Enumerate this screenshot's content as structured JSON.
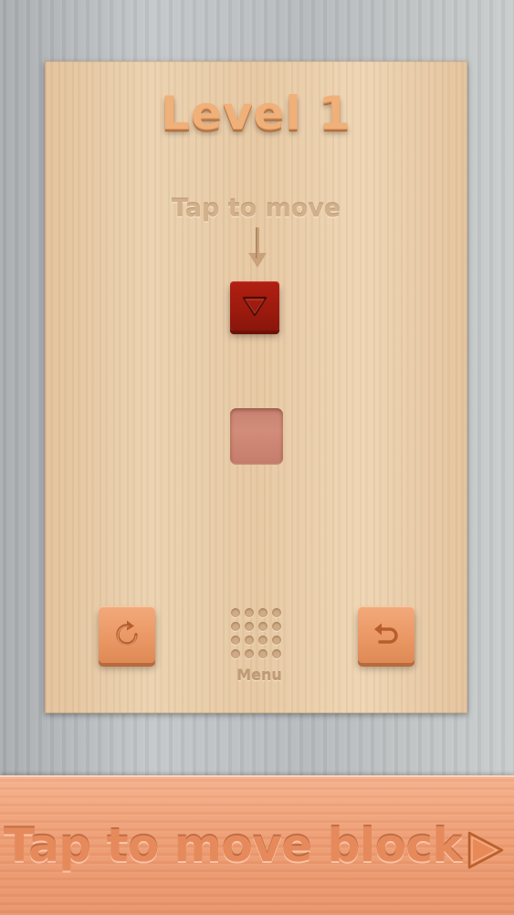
{
  "board": {
    "title": "Level 1",
    "hint": "Tap to move",
    "block": {
      "color": "#a51c10",
      "direction_icon": "triangle-down-icon"
    },
    "target": {
      "color": "#c98271"
    }
  },
  "controls": {
    "restart_icon": "restart-icon",
    "undo_icon": "undo-icon",
    "menu_icon": "grid-dots-icon",
    "menu_label": "Menu"
  },
  "banner": {
    "text": "Tap to move block",
    "arrow_icon": "play-arrow-icon"
  },
  "colors": {
    "button_orange": "#ea9865",
    "wood_light": "#ebd2b0",
    "background_gray": "#b6babc"
  }
}
